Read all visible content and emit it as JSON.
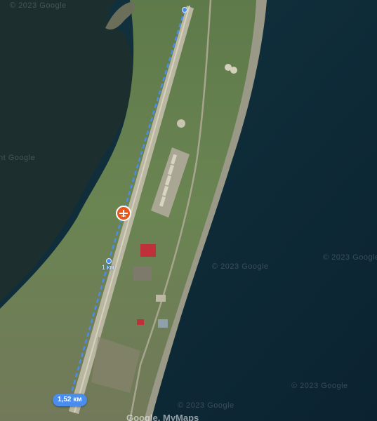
{
  "map": {
    "watermarks": [
      "© 2023 Google",
      "© 2023 Google",
      "© 2023 Google",
      "© 2023 Google",
      "© 2023 Google",
      "© 2023 Google",
      "ht Google"
    ],
    "route": {
      "km_marker_label": "1 км",
      "total_distance_label": "1,52 км",
      "color": "#4a8dec"
    },
    "airport_pin": {
      "icon": "airplane-icon",
      "color": "#e8571e"
    },
    "attribution": "Google, MyMaps"
  }
}
